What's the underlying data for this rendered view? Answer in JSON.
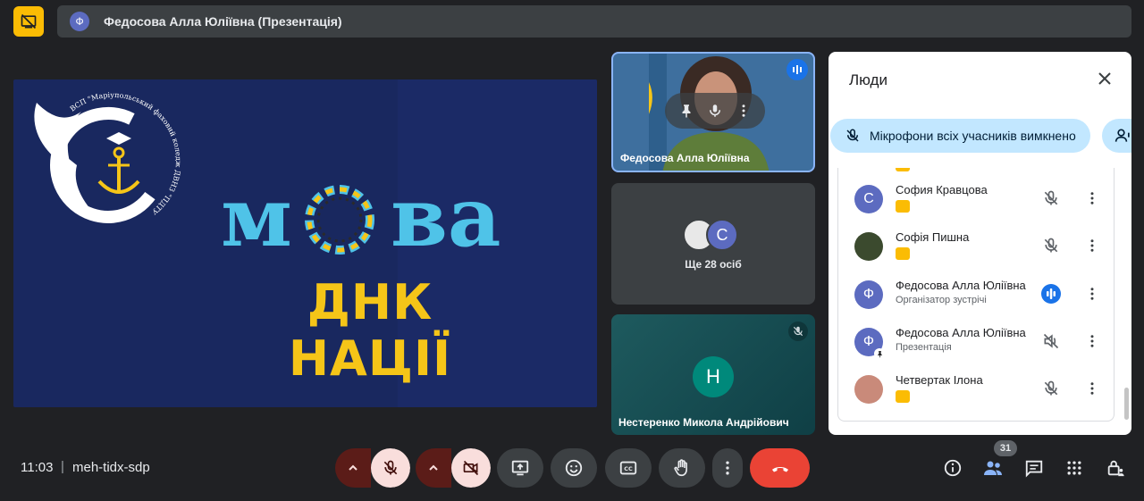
{
  "header": {
    "presenter_initial": "Ф",
    "title": "Федосова Алла Юліївна (Презентація)"
  },
  "slide": {
    "word_left": "м",
    "word_right": "ва",
    "subtitle": "ДНК НАЦІЇ",
    "logo_text": "ВСП \"Маріупольський фаховий коледж ДВНЗ \"ПДТУ\""
  },
  "tiles": {
    "speaker_name": "Федосова Алла Юліївна",
    "more_avatar_letter": "C",
    "more_label": "Ще 28 осіб",
    "third_initial": "Н",
    "third_name": "Нестеренко Микола Андрійович"
  },
  "panel": {
    "title": "Люди",
    "mute_all_label": "Мікрофони всіх учасників вимкнено",
    "participants": [
      {
        "initial": "С",
        "name": "София Кравцова",
        "sub": "",
        "color": "#5c6bc0",
        "mic": "muted"
      },
      {
        "initial": "",
        "name": "Софія Пишна",
        "sub": "",
        "color": "#3b4a2e",
        "mic": "muted"
      },
      {
        "initial": "Ф",
        "name": "Федосова Алла Юліївна",
        "sub": "Організатор зустрічі",
        "color": "#5c6bc0",
        "mic": "speaking"
      },
      {
        "initial": "Ф",
        "name": "Федосова Алла Юліївна",
        "sub": "Презентація",
        "color": "#5c6bc0",
        "mic": "sound-off"
      },
      {
        "initial": "",
        "name": "Четвертак Ілона",
        "sub": "",
        "color": "#c98a7a",
        "mic": "muted"
      }
    ]
  },
  "bottom": {
    "time": "11:03",
    "separator": "|",
    "meeting_code": "meh-tidx-sdp",
    "people_count": "31"
  },
  "colors": {
    "background": "#202124",
    "accent_yellow": "#fbbc04",
    "end_call_red": "#ea4335",
    "mute_pill": "#c2e7ff",
    "speaking_blue": "#1a73e8"
  }
}
